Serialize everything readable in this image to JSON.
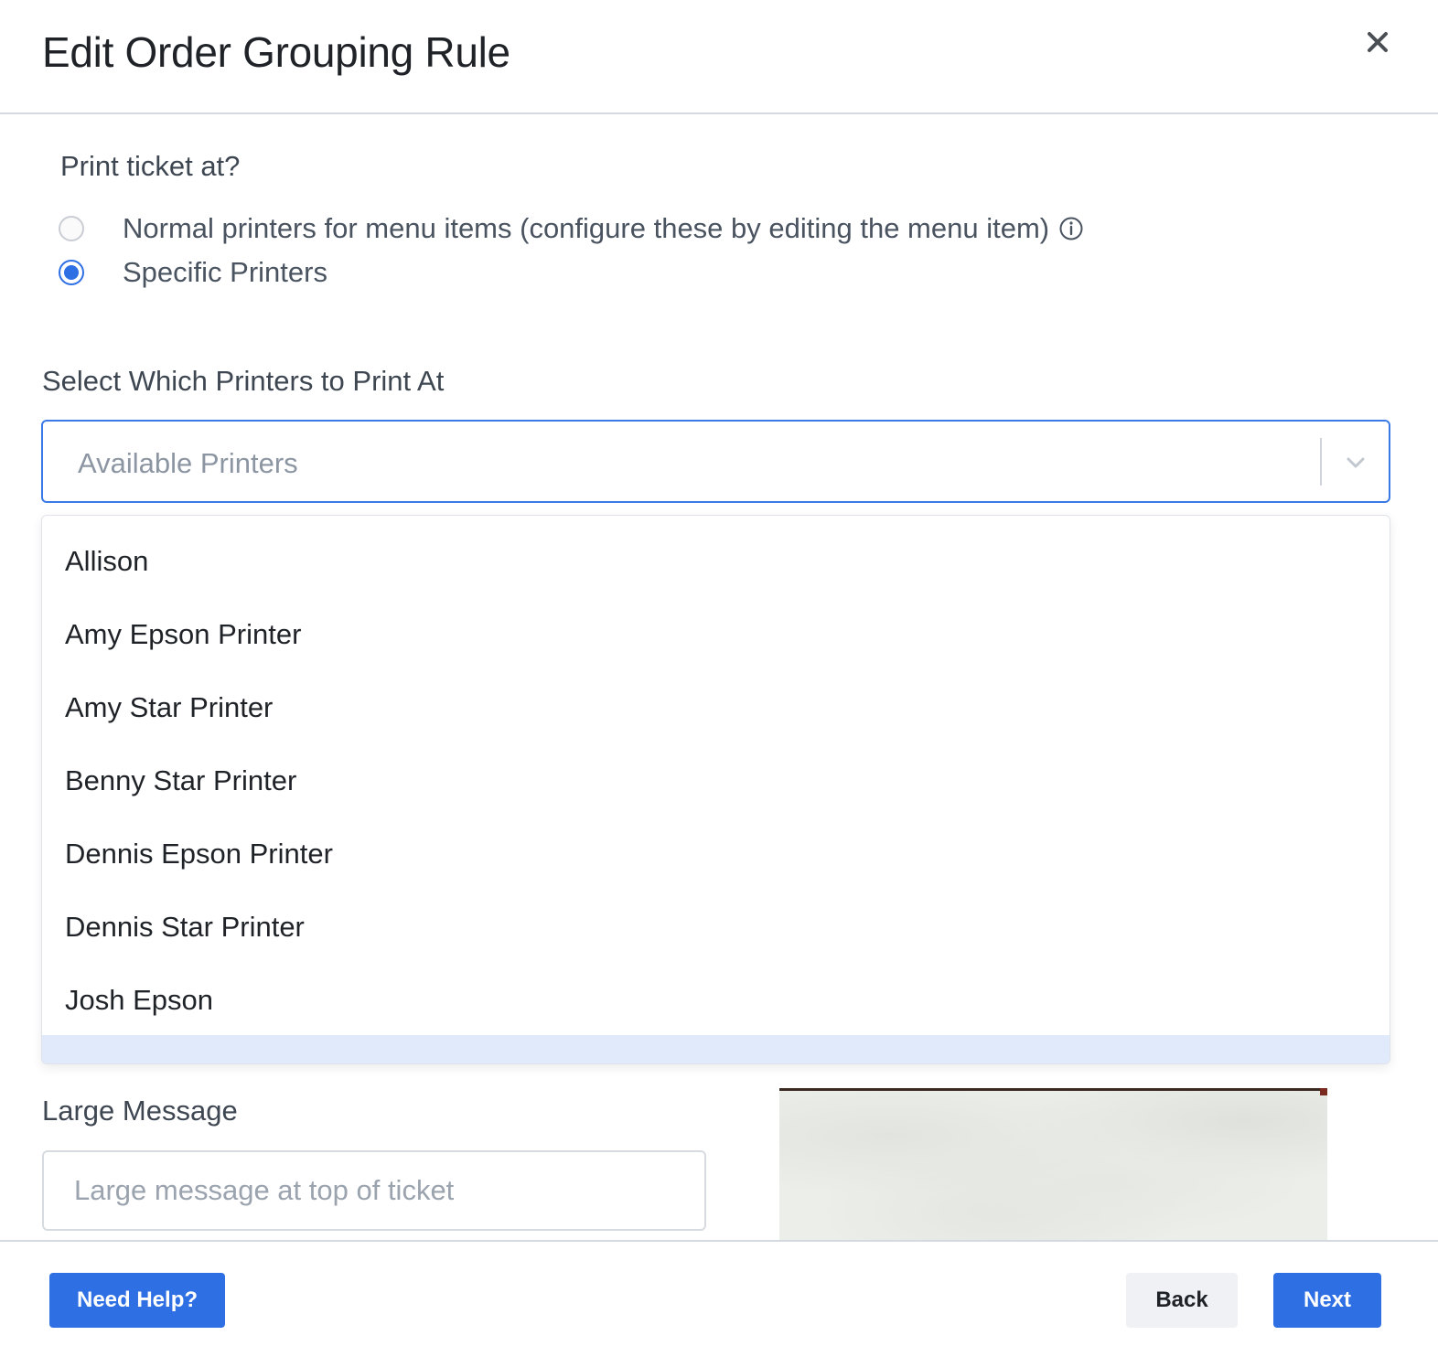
{
  "modal": {
    "title": "Edit Order Grouping Rule"
  },
  "print_at": {
    "label": "Print ticket at?",
    "options": [
      {
        "label": "Normal printers for menu items (configure these by editing the menu item)",
        "selected": false
      },
      {
        "label": "Specific Printers",
        "selected": true
      }
    ]
  },
  "printers": {
    "label": "Select Which Printers to Print At",
    "placeholder": "Available Printers",
    "options": [
      "Allison",
      "Amy Epson Printer",
      "Amy Star Printer",
      "Benny Star Printer",
      "Dennis Epson Printer",
      "Dennis Star Printer",
      "Josh Epson"
    ]
  },
  "large_message": {
    "label": "Large Message",
    "placeholder": "Large message at top of ticket"
  },
  "footer": {
    "help_label": "Need Help?",
    "back_label": "Back",
    "next_label": "Next"
  },
  "colors": {
    "accent": "#2f6fe4",
    "highlight": "#e0eafb"
  },
  "icons": [
    "close-icon",
    "info-icon",
    "chevron-down-icon"
  ]
}
